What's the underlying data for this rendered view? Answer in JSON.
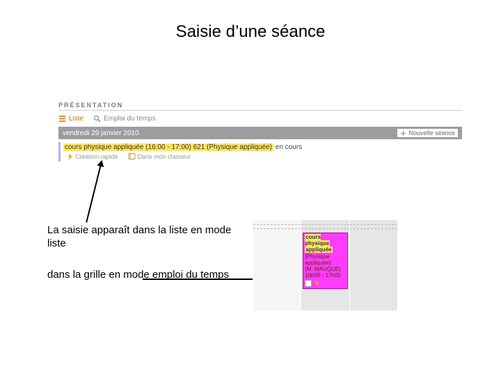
{
  "slide": {
    "title": "Saisie d’une séance"
  },
  "list_panel": {
    "presentation_label": "PRÉSENTATION",
    "tabs": {
      "list": "Liste",
      "timetable": "Emploi du temps"
    },
    "date_bar": {
      "date": "vendredi 29 janvier 2010",
      "new_session": "Nouvelle séance"
    },
    "session": {
      "highlight": "cours physique appliquée (16:00 - 17:00) 621 (Physique appliquée)",
      "status": "en cours",
      "actions": {
        "quick": "Création rapide",
        "binder": "Dans mon classeur"
      }
    }
  },
  "captions": {
    "c1": "La saisie apparaît dans la liste en mode liste",
    "c2": "dans la grille en mode emploi du temps"
  },
  "grid_event": {
    "title_line1": "cours physique",
    "title_line2": "appliquée",
    "subject": "(Physique appliquée)",
    "teacher": "(M. MAUQUE)",
    "time": "16h00 - 17h00"
  }
}
